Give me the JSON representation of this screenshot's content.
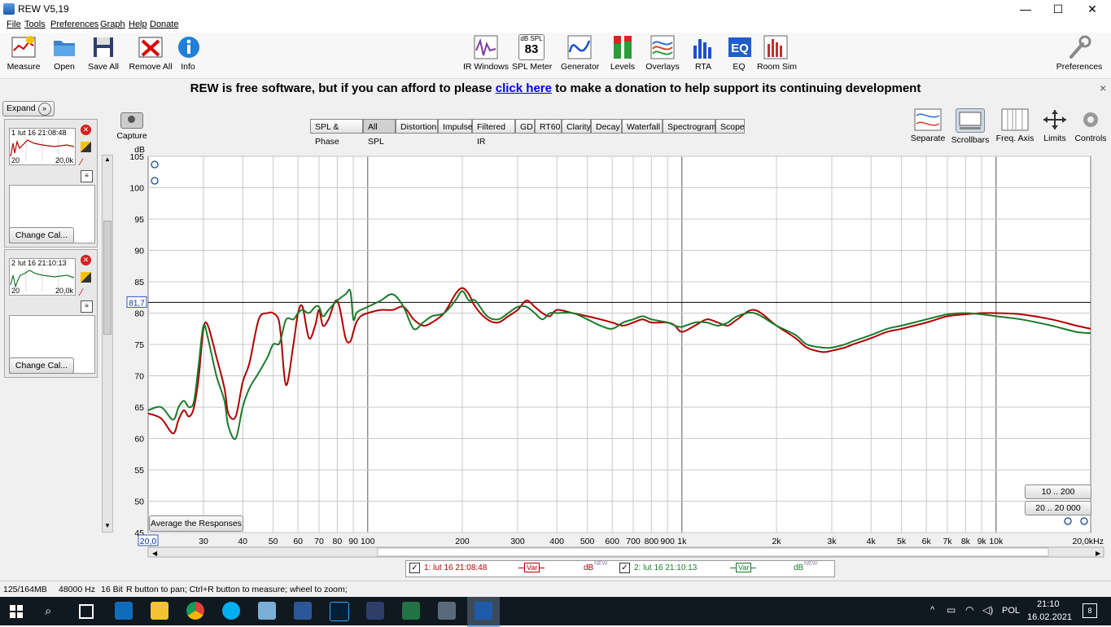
{
  "window": {
    "title": "REW V5,19",
    "min": "—",
    "max": "☐",
    "close": "✕"
  },
  "menu": [
    "File",
    "Tools",
    "Preferences",
    "Graph",
    "Help",
    "Donate"
  ],
  "toolbar_left": [
    {
      "label": "Measure",
      "icon": "measure-icon"
    },
    {
      "label": "Open",
      "icon": "folder-icon"
    },
    {
      "label": "Save All",
      "icon": "save-icon"
    },
    {
      "label": "Remove All",
      "icon": "remove-icon"
    },
    {
      "label": "Info",
      "icon": "info-icon"
    }
  ],
  "toolbar_center": [
    {
      "label": "IR Windows",
      "icon": "ir-windows-icon"
    },
    {
      "label": "SPL Meter",
      "icon": "spl-meter-icon",
      "meter_top": "dB SPL",
      "meter_value": "83"
    },
    {
      "label": "Generator",
      "icon": "generator-icon"
    },
    {
      "label": "Levels",
      "icon": "levels-icon"
    },
    {
      "label": "Overlays",
      "icon": "overlays-icon"
    },
    {
      "label": "RTA",
      "icon": "rta-icon"
    },
    {
      "label": "EQ",
      "icon": "eq-icon"
    },
    {
      "label": "Room Sim",
      "icon": "room-sim-icon"
    }
  ],
  "toolbar_right": {
    "label": "Preferences",
    "icon": "wrench-icon"
  },
  "banner": {
    "before": "REW is free software, but if you can afford to please ",
    "link": "click here",
    "after": " to make a donation to help support its continuing development",
    "close": "×"
  },
  "left_panel": {
    "expand": "Expand",
    "measurements": [
      {
        "index": "1",
        "name": "lut 16 21:08:48",
        "axis_min": "20",
        "axis_max": "20,0k",
        "change": "Change Cal...",
        "color": "#b00000"
      },
      {
        "index": "2",
        "name": "lut 16 21:10:13",
        "axis_min": "20",
        "axis_max": "20,0k",
        "change": "Change Cal...",
        "color": "#1a7a2a"
      }
    ]
  },
  "capture": "Capture",
  "tabs": [
    "SPL & Phase",
    "All SPL",
    "Distortion",
    "Impulse",
    "Filtered IR",
    "GD",
    "RT60",
    "Clarity",
    "Decay",
    "Waterfall",
    "Spectrogram",
    "Scope"
  ],
  "active_tab": "All SPL",
  "right_controls": [
    "Separate",
    "Scrollbars",
    "Freq. Axis",
    "Limits",
    "Controls"
  ],
  "graph": {
    "y_unit": "dB",
    "y_ticks": [
      "105",
      "100",
      "95",
      "90",
      "85",
      "80",
      "75",
      "70",
      "65",
      "60",
      "55",
      "50",
      "45"
    ],
    "x_ticks": [
      "20,0",
      "30",
      "40",
      "50",
      "60",
      "70",
      "80",
      "90",
      "100",
      "200",
      "300",
      "400",
      "500",
      "600",
      "700",
      "800",
      "900",
      "1k",
      "2k",
      "3k",
      "4k",
      "5k",
      "6k",
      "7k",
      "8k",
      "9k",
      "10k",
      "20,0kHz"
    ],
    "cursor_value": "81,7",
    "average_button": "Average the Responses",
    "range_btn1": "10 .. 200",
    "range_btn2": "20 .. 20 000"
  },
  "chart_data": {
    "type": "line",
    "xscale": "log",
    "xlim": [
      20,
      20000
    ],
    "ylim": [
      45,
      105
    ],
    "ylabel": "dB",
    "xlabel": "",
    "cursor_y": 81.7,
    "series": [
      {
        "name": "1: lut 16 21:08:48",
        "color": "#b00000",
        "x": [
          20,
          22,
          24,
          25,
          26,
          27,
          28,
          29,
          30,
          31,
          33,
          35,
          36,
          38,
          40,
          42,
          45,
          48,
          50,
          52,
          53,
          55,
          58,
          60,
          62,
          65,
          68,
          70,
          72,
          75,
          80,
          85,
          88,
          90,
          92,
          95,
          100,
          110,
          120,
          130,
          140,
          150,
          160,
          175,
          190,
          200,
          210,
          220,
          240,
          260,
          280,
          300,
          320,
          340,
          360,
          380,
          400,
          450,
          500,
          550,
          600,
          650,
          700,
          750,
          800,
          900,
          950,
          1000,
          1100,
          1200,
          1300,
          1400,
          1500,
          1700,
          2000,
          2300,
          2500,
          2800,
          3000,
          3300,
          3500,
          4000,
          4500,
          5000,
          6000,
          7000,
          8000,
          9000,
          10000,
          12000,
          15000,
          18000,
          20000
        ],
        "y": [
          64,
          63.2,
          60.8,
          63,
          64.5,
          63.5,
          65,
          70,
          77.5,
          78,
          73,
          68,
          64,
          63.5,
          69,
          72,
          79,
          80,
          80,
          79,
          76,
          68.5,
          75,
          80,
          81,
          76,
          78,
          80.5,
          78,
          79,
          82,
          76,
          75.5,
          77,
          78.5,
          79.5,
          80,
          80.5,
          80.5,
          81,
          79,
          78,
          78.5,
          80,
          83,
          84,
          83,
          81,
          79,
          78.5,
          79.5,
          80.5,
          82,
          81,
          80,
          79.5,
          80.5,
          80,
          79.5,
          79,
          78.5,
          78,
          78.5,
          79,
          78.5,
          78.5,
          78,
          77,
          78,
          79,
          78.5,
          78,
          79,
          80.5,
          78,
          76,
          74.5,
          73.8,
          74,
          74.5,
          75,
          76,
          77,
          77.5,
          78.5,
          79.5,
          79.8,
          80,
          80,
          79.8,
          79,
          78,
          77.5
        ]
      },
      {
        "name": "2: lut 16 21:10:13",
        "color": "#1a7a2a",
        "x": [
          20,
          22,
          24,
          25,
          26,
          27,
          28,
          29,
          30,
          31,
          33,
          35,
          36,
          38,
          40,
          42,
          45,
          48,
          50,
          52,
          53,
          55,
          58,
          60,
          62,
          65,
          68,
          70,
          72,
          75,
          80,
          85,
          88,
          90,
          92,
          95,
          100,
          110,
          120,
          130,
          140,
          150,
          160,
          175,
          190,
          200,
          210,
          220,
          240,
          260,
          280,
          300,
          320,
          340,
          360,
          380,
          400,
          450,
          500,
          550,
          600,
          650,
          700,
          750,
          800,
          900,
          950,
          1000,
          1100,
          1200,
          1300,
          1400,
          1500,
          1700,
          2000,
          2300,
          2500,
          2800,
          3000,
          3300,
          3500,
          4000,
          4500,
          5000,
          6000,
          7000,
          8000,
          9000,
          10000,
          12000,
          15000,
          18000,
          20000
        ],
        "y": [
          64.5,
          65,
          63,
          65,
          66,
          65,
          66,
          72,
          78,
          76,
          70,
          66,
          62,
          60,
          65,
          68,
          70.5,
          73,
          75,
          75,
          76,
          79,
          79,
          80,
          80.5,
          80,
          81,
          81,
          79.5,
          80.5,
          82,
          83,
          83.5,
          79,
          80,
          80.5,
          81,
          82,
          83,
          81,
          77.5,
          78.5,
          79.5,
          80,
          82,
          83.5,
          82,
          82,
          79.5,
          79,
          80,
          81,
          81,
          80,
          79,
          80,
          80,
          80,
          79,
          78,
          77.5,
          78.5,
          79,
          79.5,
          79,
          78.5,
          78,
          77.8,
          78.5,
          78.5,
          78,
          78.5,
          79.5,
          80,
          78,
          76.5,
          75,
          74.5,
          74.5,
          75,
          75.5,
          76.5,
          77.5,
          78,
          79,
          79.8,
          80,
          79.8,
          79.5,
          79,
          78,
          77,
          76.8
        ]
      }
    ]
  },
  "legend": [
    {
      "check": "✓",
      "label": "1: lut 16 21:08:48",
      "var": "Var",
      "unit": "dB",
      "badge": "NEW",
      "color": "#b00000"
    },
    {
      "check": "✓",
      "label": "2: lut 16 21:10:13",
      "var": "Var",
      "unit": "dB",
      "badge": "NEW",
      "color": "#1a7a2a"
    }
  ],
  "status": {
    "memory": "125/164MB",
    "rate": "48000 Hz",
    "bits": "16 Bit",
    "hint": "R button to pan; Ctrl+R button to measure; wheel to zoom;"
  },
  "taskbar": {
    "lang": "POL",
    "time": "21:10",
    "date": "16.02.2021",
    "notif": "8"
  }
}
